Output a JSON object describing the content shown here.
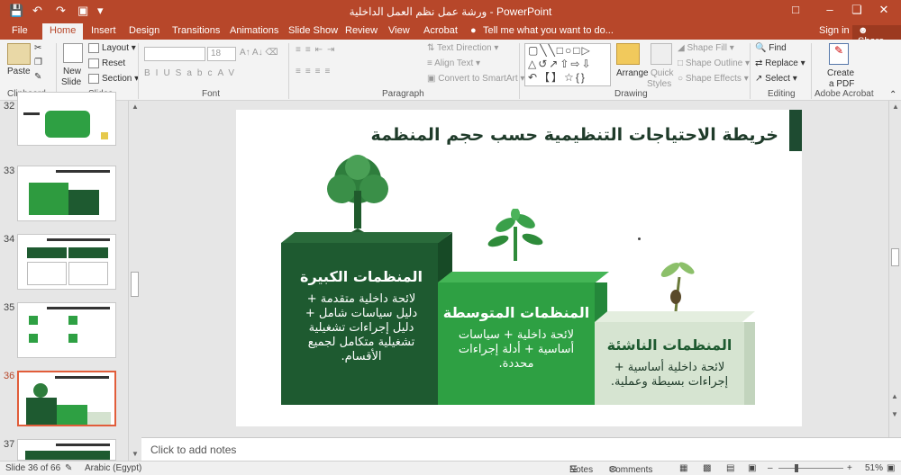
{
  "window": {
    "title": "ورشة عمل نظم العمل الداخلية - PowerPoint",
    "signin": "Sign in",
    "share": "Share"
  },
  "tabs": [
    "File",
    "Home",
    "Insert",
    "Design",
    "Transitions",
    "Animations",
    "Slide Show",
    "Review",
    "View",
    "Acrobat"
  ],
  "tell_me": "Tell me what you want to do...",
  "ribbon": {
    "clipboard": {
      "paste": "Paste",
      "label": "Clipboard"
    },
    "slides": {
      "new_slide": "New",
      "new_slide2": "Slide",
      "layout": "Layout",
      "reset": "Reset",
      "section": "Section",
      "label": "Slides"
    },
    "font": {
      "size": "18",
      "label": "Font"
    },
    "paragraph": {
      "text_direction": "Text Direction",
      "align_text": "Align Text",
      "smartart": "Convert to SmartArt",
      "label": "Paragraph"
    },
    "drawing": {
      "arrange": "Arrange",
      "quick_styles": "Quick",
      "quick_styles2": "Styles",
      "shape_fill": "Shape Fill",
      "shape_outline": "Shape Outline",
      "shape_effects": "Shape Effects",
      "label": "Drawing"
    },
    "editing": {
      "find": "Find",
      "replace": "Replace",
      "select": "Select",
      "label": "Editing"
    },
    "acrobat": {
      "create": "Create",
      "create2": "a PDF",
      "label": "Adobe Acrobat"
    }
  },
  "thumbnails": [
    "32",
    "33",
    "34",
    "35",
    "36",
    "37"
  ],
  "slide": {
    "title": "خريطة الاحتياجات التنظيمية حسب حجم المنظمة",
    "large": {
      "title": "المنظمات الكبيرة",
      "l1": "لائحة داخلية متقدمة +",
      "l2": "دليل سياسات شامل +",
      "l3": "دليل إجراءات تشغيلية",
      "l4": "تشغيلية متكامل لجميع",
      "l5": "الأقسام."
    },
    "medium": {
      "title": "المنظمات المتوسطة",
      "l1": "لائحة داخلية + سياسات",
      "l2": "أساسية + أدلة إجراءات",
      "l3": "محددة."
    },
    "small": {
      "title": "المنظمات الناشئة",
      "l1": "لائحة داخلية أساسية +",
      "l2": "إجراءات بسيطة وعملية."
    }
  },
  "notes_placeholder": "Click to add notes",
  "status": {
    "slide": "Slide 36 of 66",
    "language": "Arabic (Egypt)",
    "notes": "Notes",
    "comments": "Comments",
    "zoom": "51%"
  },
  "colors": {
    "accent": "#b7472a",
    "dark_green": "#1e5a30",
    "mid_green": "#2ea043",
    "light_green": "#d4e2cf"
  }
}
